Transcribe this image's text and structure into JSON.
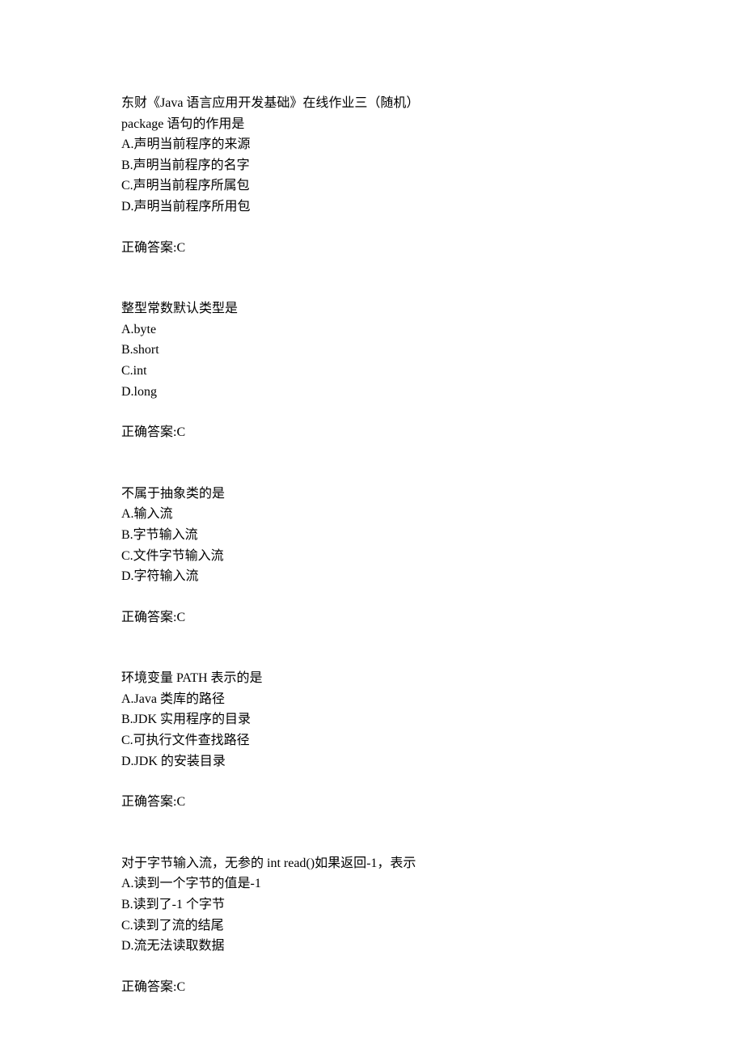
{
  "title": "东财《Java 语言应用开发基础》在线作业三（随机）",
  "questions": [
    {
      "text": "package 语句的作用是",
      "options": [
        "A.声明当前程序的来源",
        "B.声明当前程序的名字",
        "C.声明当前程序所属包",
        "D.声明当前程序所用包"
      ],
      "answer": "正确答案:C"
    },
    {
      "text": "整型常数默认类型是",
      "options": [
        "A.byte",
        "B.short",
        "C.int",
        "D.long"
      ],
      "answer": "正确答案:C"
    },
    {
      "text": "不属于抽象类的是",
      "options": [
        "A.输入流",
        "B.字节输入流",
        "C.文件字节输入流",
        "D.字符输入流"
      ],
      "answer": "正确答案:C"
    },
    {
      "text": "环境变量 PATH 表示的是",
      "options": [
        "A.Java 类库的路径",
        "B.JDK 实用程序的目录",
        "C.可执行文件查找路径",
        "D.JDK 的安装目录"
      ],
      "answer": "正确答案:C"
    },
    {
      "text": "对于字节输入流，无参的 int read()如果返回-1，表示",
      "options": [
        "A.读到一个字节的值是-1",
        "B.读到了-1 个字节",
        "C.读到了流的结尾",
        "D.流无法读取数据"
      ],
      "answer": "正确答案:C"
    }
  ]
}
